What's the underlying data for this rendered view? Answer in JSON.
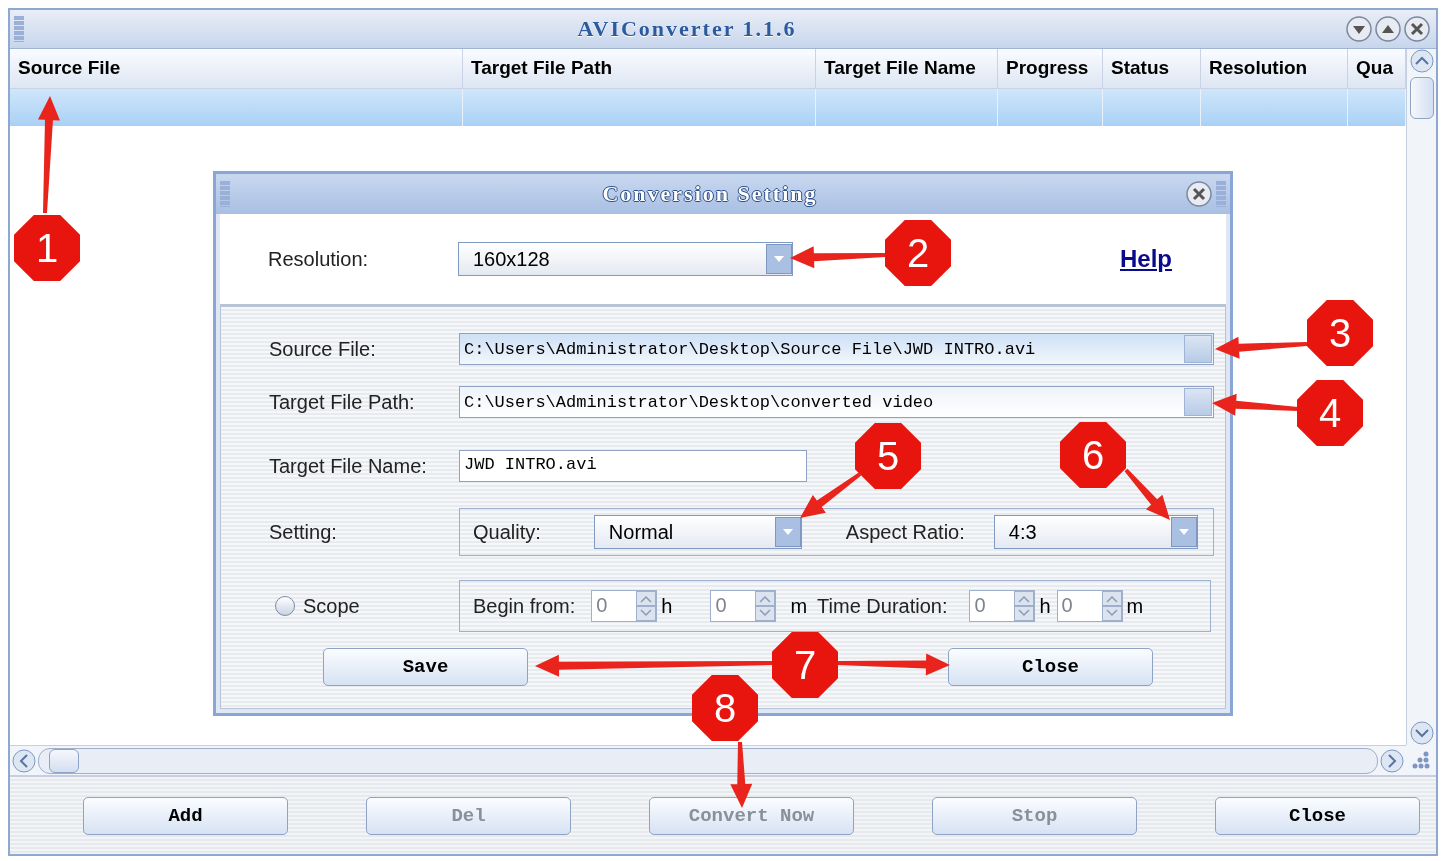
{
  "window": {
    "title": "AVIConverter 1.1.6"
  },
  "table": {
    "columns": [
      "Source File",
      "Target File Path",
      "Target File Name",
      "Progress",
      "Status",
      "Resolution",
      "Qua"
    ],
    "rows": [
      {
        "selected": true
      }
    ]
  },
  "buttons": [
    {
      "label": "Add",
      "disabled": false
    },
    {
      "label": "Del",
      "disabled": true
    },
    {
      "label": "Convert Now",
      "disabled": true
    },
    {
      "label": "Stop",
      "disabled": true
    },
    {
      "label": "Close",
      "disabled": false
    }
  ],
  "dialog": {
    "title": "Conversion Setting",
    "resolution": {
      "label": "Resolution:",
      "value": "160x128"
    },
    "help_link": "Help",
    "source_file": {
      "label": "Source File:",
      "value": "C:\\Users\\Administrator\\Desktop\\Source File\\JWD INTRO.avi"
    },
    "target_path": {
      "label": "Target File Path:",
      "value": "C:\\Users\\Administrator\\Desktop\\converted video"
    },
    "target_name": {
      "label": "Target File Name:",
      "value": "JWD INTRO.avi"
    },
    "setting": {
      "label": "Setting:",
      "quality": {
        "label": "Quality:",
        "value": "Normal"
      },
      "aspect_ratio": {
        "label": "Aspect Ratio:",
        "value": "4:3"
      }
    },
    "scope": {
      "label": "Scope",
      "checked": false,
      "begin": {
        "label": "Begin from:",
        "spinners": [
          {
            "value": "0",
            "unit": "h",
            "disabled": true
          },
          {
            "value": "0",
            "unit": "m",
            "disabled": true
          }
        ]
      },
      "duration": {
        "label": "Time Duration:",
        "spinners": [
          {
            "value": "0",
            "unit": "h",
            "disabled": true
          },
          {
            "value": "0",
            "unit": "m",
            "disabled": true
          }
        ]
      }
    },
    "buttons": [
      {
        "label": "Save"
      },
      {
        "label": "Close"
      }
    ]
  },
  "callouts": [
    {
      "number": "1"
    },
    {
      "number": "2"
    },
    {
      "number": "3"
    },
    {
      "number": "4"
    },
    {
      "number": "5"
    },
    {
      "number": "6"
    },
    {
      "number": "7"
    },
    {
      "number": "8"
    }
  ]
}
